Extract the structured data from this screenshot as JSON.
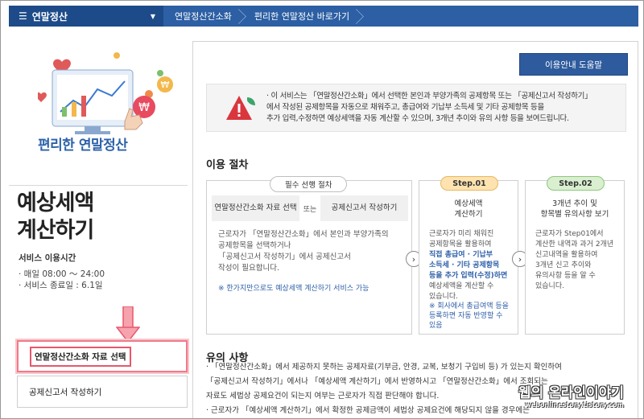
{
  "topbar": {
    "menu_label": "연말정산",
    "crumbs": [
      "연말정산간소화",
      "편리한 연말정산 바로가기"
    ]
  },
  "left": {
    "illustration_title": "편리한 연말정산",
    "calc_title_line1": "예상세액",
    "calc_title_line2": "계산하기",
    "service_time_label": "서비스 이용시간",
    "service_hours": "· 매일 08:00 ～ 24:00",
    "service_end": "· 서비스 종료일 : 6.1일",
    "buttons": [
      "연말정산간소화 자료 선택",
      "공제신고서 작성하기"
    ]
  },
  "right": {
    "help_button": "이용안내 도움말",
    "notice_lines": [
      "· 이 서비스는 「연말정산간소화」에서 선택한 본인과 부양가족의 공제항목 또는 「공제신고서 작성하기」",
      "  에서 작성된 공제항목을 자동으로 채워주고, 총급여와 기납부 소득세 및 기타 공제항목 등을",
      "  추가 입력,수정하면 예상세액을 자동 계산할 수 있으며, 3개년 추이와 유의 사항 등을 보여드립니다."
    ],
    "procedure_title": "이용 절차",
    "required": {
      "pill": "필수 선행 절차",
      "tab1": "연말정산간소화 자료 선택",
      "or": "또는",
      "tab2": "공제신고서 작성하기",
      "desc_lines": [
        "근로자가 「연말정산간소화」에서 본인과 부양가족의",
        "공제항목을 선택하거나",
        "「공제신고서 작성하기」에서 공제신고서",
        "  작성이 필요합니다."
      ],
      "note": "※ 한가지만으로도 예상세액 계산하기 서비스 가능"
    },
    "step1": {
      "pill": "Step.01",
      "title_line1": "예상세액",
      "title_line2": "계산하기",
      "desc_lines": [
        "근로자가 미리 채워진",
        "공제항목을 활용하여",
        "직접 총급여 · 기납부",
        "소득세 · 기타 공제항목",
        "등을 추가 입력(수정)하면",
        "예상세액을 계산할 수",
        "있습니다."
      ],
      "note_lines": [
        "※ 회사에서 총급여액 등을",
        "등록하면 자동 반영할 수",
        "있음"
      ]
    },
    "step2": {
      "pill": "Step.02",
      "title_line1": "3개년 추이 및",
      "title_line2": "항목별 유의사항 보기",
      "desc_lines": [
        "근로자가 Step01에서",
        "계산한 내역과 과거 2개년",
        "신고내역을 활용하여",
        "3개년 신고 추이와",
        "유의사항 등을 알 수",
        "있습니다."
      ]
    },
    "caution_title": "유의 사항",
    "caution_lines": [
      "· 「연말정산간소화」에서 제공하지 못하는 공제자료(기부금, 안경, 교복, 보청기 구입비 등) 가 있는지 확인하여",
      "  「공제신고서 작성하기」에서나 「예상세액 계산하기」에서 반영하시고 「연말정산간소화」에서 조회되는",
      "  자료도 세법상 공제요건이 되는지 여부는 근로자가 직접 판단해야 합니다.",
      "· 근로자가 「예상세액 계산하기」에서 확정한 공제금액이 세법상 공제요건에 해당되지 않을 경우에는"
    ]
  },
  "watermark": {
    "text": "웹의 온라인이야기",
    "sub": "webonlinestory.tistory.com"
  },
  "colors": {
    "topbar": "#2c5fa3",
    "menu_block": "#1d4b8a",
    "accent_blue": "#2d5fa8",
    "step1_pill": "#fde3b0",
    "step2_pill": "#d9efd0",
    "highlight_border": "#e8576c"
  }
}
